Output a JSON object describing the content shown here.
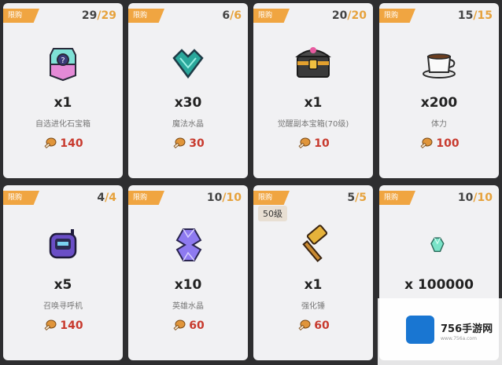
{
  "cards": [
    {
      "tag": "限购",
      "stock": "29",
      "max": "29",
      "qty": "x1",
      "name": "自选进化石宝箱",
      "price": "140"
    },
    {
      "tag": "限购",
      "stock": "6",
      "max": "6",
      "qty": "x30",
      "name": "魔法水晶",
      "price": "30"
    },
    {
      "tag": "限购",
      "stock": "20",
      "max": "20",
      "qty": "x1",
      "name": "觉醒副本宝箱(70级)",
      "price": "10"
    },
    {
      "tag": "限购",
      "stock": "15",
      "max": "15",
      "qty": "x200",
      "name": "体力",
      "price": "100"
    },
    {
      "tag": "限购",
      "stock": "4",
      "max": "4",
      "qty": "x5",
      "name": "召唤寻呼机",
      "price": "140"
    },
    {
      "tag": "限购",
      "stock": "10",
      "max": "10",
      "qty": "x10",
      "name": "英雄水晶",
      "price": "60"
    },
    {
      "tag": "限购",
      "stock": "5",
      "max": "5",
      "qty": "x1",
      "name": "强化锤",
      "price": "60",
      "level": "50级"
    },
    {
      "tag": "限购",
      "stock": "10",
      "max": "10",
      "qty": "x 100000",
      "name": "",
      "price": ""
    }
  ],
  "watermark": {
    "brand": "756手游网",
    "url": "www.756a.com"
  },
  "icons": [
    "evolution-stone-chest-icon",
    "magic-crystal-icon",
    "awaken-chest-icon",
    "coffee-cup-icon",
    "summon-pager-icon",
    "hero-crystal-icon",
    "forge-hammer-icon",
    "gem-shard-icon",
    "drumstick-icon"
  ]
}
